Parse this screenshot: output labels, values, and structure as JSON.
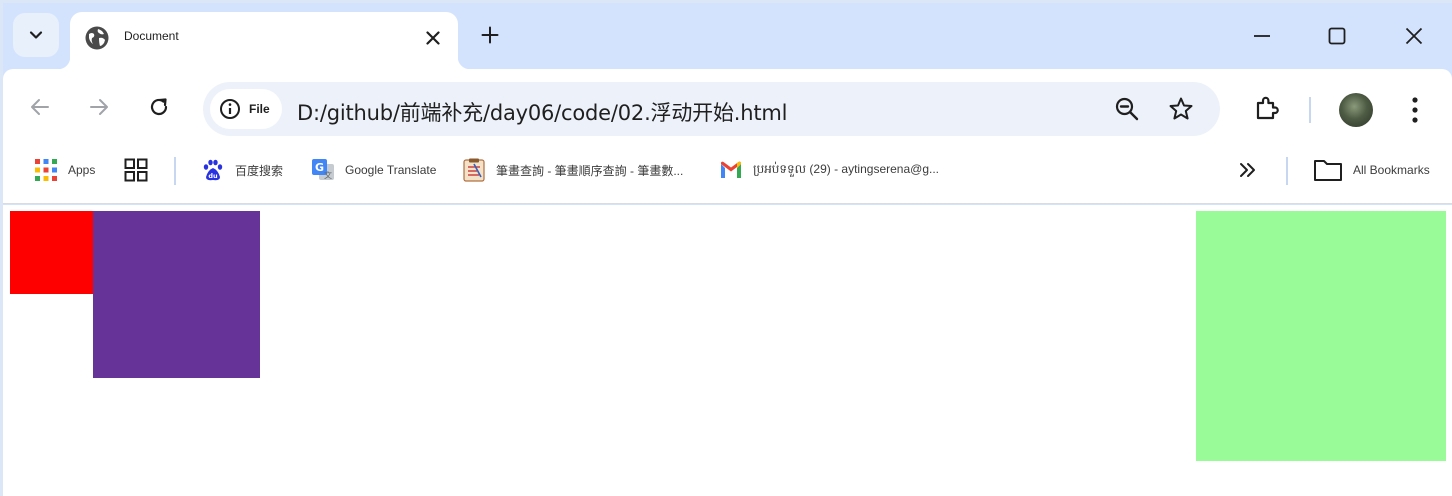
{
  "tab": {
    "title": "Document",
    "close_icon": "close-icon",
    "favicon": "globe-icon"
  },
  "toolbar": {
    "site_chip_label": "File",
    "url": "D:/github/前端补充/day06/code/02.浮动开始.html"
  },
  "bookmarks": [
    {
      "label": "Apps",
      "icon": "apps-grid-icon"
    },
    {
      "label": "",
      "icon": "tab-groups-icon"
    },
    {
      "label": "百度搜索",
      "icon": "baidu-icon"
    },
    {
      "label": "Google Translate",
      "icon": "google-translate-icon"
    },
    {
      "label": "筆畫查詢 - 筆畫順序查詢 - 筆畫數...",
      "icon": "stroke-lookup-icon"
    },
    {
      "label": "ប្រអប់ទទួល (29) - aytingserena@g...",
      "icon": "gmail-icon"
    }
  ],
  "all_bookmarks_label": "All Bookmarks",
  "colors": {
    "red_box": "#ff0000",
    "purple_box": "#663399",
    "green_box": "#98fb98",
    "frame": "#d3e3fd",
    "omnibox": "#edf2fa"
  }
}
